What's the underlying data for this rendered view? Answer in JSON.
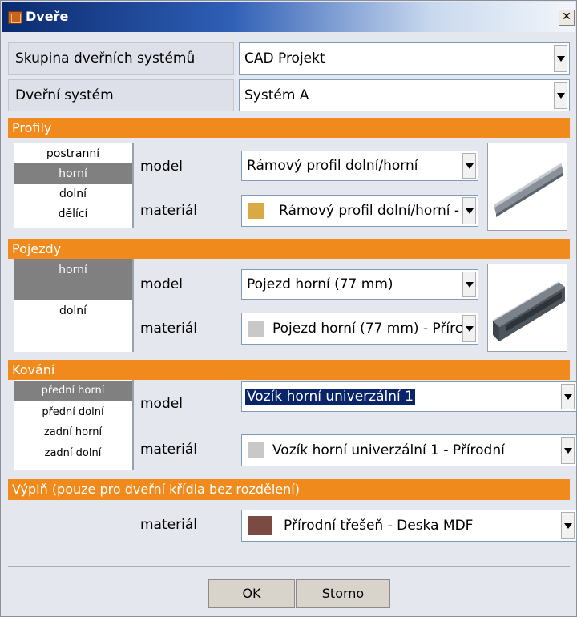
{
  "window": {
    "title": "Dveře",
    "close_glyph": "✕"
  },
  "group": {
    "label": "Skupina dveřních systémů",
    "value": "CAD Projekt"
  },
  "system": {
    "label": "Dveřní systém",
    "value": "Systém A"
  },
  "profily": {
    "header": "Profily",
    "items": [
      "postranní",
      "horní",
      "dolní",
      "dělící"
    ],
    "selected": "horní",
    "model_label": "model",
    "model_value": "Rámový profil dolní/horní",
    "material_label": "materiál",
    "material_value": "Rámový profil dolní/horní -",
    "material_color": "#d9a943"
  },
  "pojezdy": {
    "header": "Pojezdy",
    "items": [
      "horní",
      "dolní"
    ],
    "selected": "horní",
    "model_label": "model",
    "model_value": "Pojezd horní (77 mm)",
    "material_label": "materiál",
    "material_value": "Pojezd horní (77 mm) - Přírc",
    "material_color": "#c8c8c8"
  },
  "kovani": {
    "header": "Kování",
    "items": [
      "přední horní",
      "přední dolní",
      "zadní horní",
      "zadní dolní"
    ],
    "selected": "přední horní",
    "model_label": "model",
    "model_value": "Vozík horní univerzální 1",
    "material_label": "materiál",
    "material_value": "Vozík horní univerzální 1 - Přírodní",
    "material_color": "#c8c8c8"
  },
  "vypln": {
    "header": "Výplň (pouze pro dveřní křídla bez rozdělení)",
    "material_label": "materiál",
    "material_value": "Přírodní třešeň - Deska MDF",
    "material_color": "#7a4a43"
  },
  "buttons": {
    "ok": "OK",
    "cancel": "Storno"
  },
  "colors": {
    "section_header": "#f08a1c",
    "selection": "#808080",
    "highlight": "#0a246a"
  },
  "icons": {
    "app": "door-icon",
    "dropdown": "chevron-down-icon",
    "profile_preview": "rail-profile-icon",
    "track_preview": "track-rail-icon"
  }
}
